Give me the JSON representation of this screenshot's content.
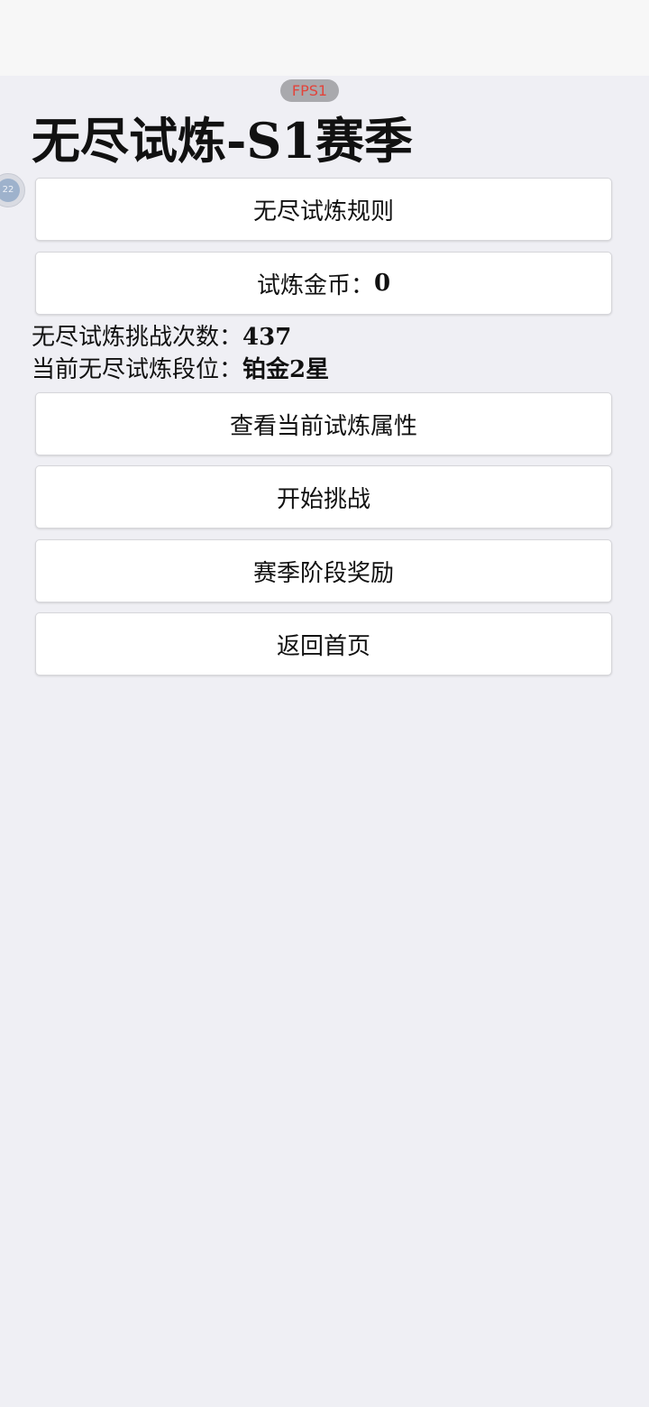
{
  "status_bar": {
    "fps_label": "FPS1"
  },
  "floating_assistant": {
    "label": "22"
  },
  "page": {
    "title": "无尽试炼-S1赛季"
  },
  "buttons": {
    "rules": "无尽试炼规则",
    "coins_label": "试炼金币：",
    "coins_value": "0",
    "view_attributes": "查看当前试炼属性",
    "start_challenge": "开始挑战",
    "season_rewards": "赛季阶段奖励",
    "back_home": "返回首页"
  },
  "stats": {
    "challenge_count_label": "无尽试炼挑战次数：",
    "challenge_count_value": "437",
    "rank_label": "当前无尽试炼段位：",
    "rank_value": "铂金2星"
  },
  "colors": {
    "background": "#efeff4",
    "top_bar": "#f7f7f7",
    "fps_text": "#e2443b",
    "fps_badge": "#a9a9ad",
    "button_bg": "#ffffff"
  }
}
